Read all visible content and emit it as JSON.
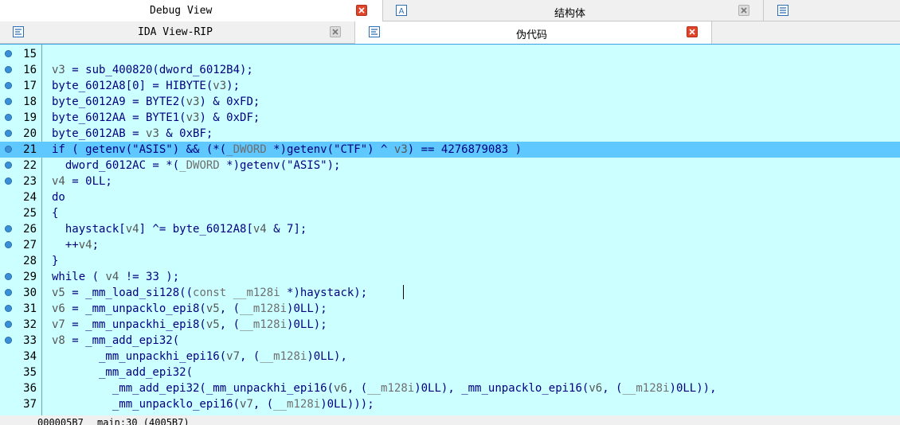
{
  "tabs_top": [
    {
      "label": "Debug View",
      "active": true
    },
    {
      "label": "结构体",
      "active": false
    }
  ],
  "tabs_second": [
    {
      "label": "IDA View-RIP",
      "active": false
    },
    {
      "label": "伪代码",
      "active": true
    }
  ],
  "lines": [
    {
      "num": "15",
      "bp": true,
      "html": ""
    },
    {
      "num": "16",
      "bp": true,
      "html": "<span class=\"v\">v3</span> = sub_400820(dword_6012B4);"
    },
    {
      "num": "17",
      "bp": true,
      "html": "byte_6012A8[0] = HIBYTE(<span class=\"v\">v3</span>);"
    },
    {
      "num": "18",
      "bp": true,
      "html": "byte_6012A9 = BYTE2(<span class=\"v\">v3</span>) &amp; 0xFD;"
    },
    {
      "num": "19",
      "bp": true,
      "html": "byte_6012AA = BYTE1(<span class=\"v\">v3</span>) &amp; 0xDF;"
    },
    {
      "num": "20",
      "bp": true,
      "html": "byte_6012AB = <span class=\"v\">v3</span> &amp; 0xBF;"
    },
    {
      "num": "21",
      "bp": true,
      "hl": true,
      "html": "if ( getenv(\"ASIS\") &amp;&amp; (*(<span class=\"c\">_DWORD</span> *)getenv(\"CTF\") ^ <span class=\"v\">v3</span>) == 4276879083 )"
    },
    {
      "num": "22",
      "bp": true,
      "html": "  dword_6012AC = *(<span class=\"c\">_DWORD</span> *)getenv(\"ASIS\");"
    },
    {
      "num": "23",
      "bp": true,
      "html": "<span class=\"v\">v4</span> = 0LL;"
    },
    {
      "num": "24",
      "bp": false,
      "html": "do"
    },
    {
      "num": "25",
      "bp": false,
      "html": "{"
    },
    {
      "num": "26",
      "bp": true,
      "html": "  haystack[<span class=\"v\">v4</span>] ^= byte_6012A8[<span class=\"v\">v4</span> &amp; 7];"
    },
    {
      "num": "27",
      "bp": true,
      "html": "  ++<span class=\"v\">v4</span>;"
    },
    {
      "num": "28",
      "bp": false,
      "html": "}"
    },
    {
      "num": "29",
      "bp": true,
      "html": "while ( <span class=\"v\">v4</span> != 33 );"
    },
    {
      "num": "30",
      "bp": true,
      "html": "<span class=\"v\">v5</span> = _mm_load_si128((<span class=\"c\">const __m128i</span> *)haystack);"
    },
    {
      "num": "31",
      "bp": true,
      "html": "<span class=\"v\">v6</span> = _mm_unpacklo_epi8(<span class=\"v\">v5</span>, (<span class=\"c\">__m128i</span>)0LL);"
    },
    {
      "num": "32",
      "bp": true,
      "html": "<span class=\"v\">v7</span> = _mm_unpackhi_epi8(<span class=\"v\">v5</span>, (<span class=\"c\">__m128i</span>)0LL);"
    },
    {
      "num": "33",
      "bp": true,
      "html": "<span class=\"v\">v8</span> = _mm_add_epi32("
    },
    {
      "num": "34",
      "bp": false,
      "html": "       _mm_unpackhi_epi16(<span class=\"v\">v7</span>, (<span class=\"c\">__m128i</span>)0LL),"
    },
    {
      "num": "35",
      "bp": false,
      "html": "       _mm_add_epi32("
    },
    {
      "num": "36",
      "bp": false,
      "html": "         _mm_add_epi32(_mm_unpackhi_epi16(<span class=\"v\">v6</span>, (<span class=\"c\">__m128i</span>)0LL), _mm_unpacklo_epi16(<span class=\"v\">v6</span>, (<span class=\"c\">__m128i</span>)0LL)),"
    },
    {
      "num": "37",
      "bp": false,
      "html": "         _mm_unpacklo_epi16(<span class=\"v\">v7</span>, (<span class=\"c\">__m128i</span>)0LL)));"
    }
  ],
  "status": {
    "address": "000005B7",
    "location": "main:30 (4005B7)"
  },
  "colors": {
    "code_bg": "#ccffff",
    "highlight": "#5fc8ff",
    "identifier": "#000080",
    "variable": "#555555",
    "breakpoint": "#3b8fd6",
    "close_active": "#e0452a"
  }
}
